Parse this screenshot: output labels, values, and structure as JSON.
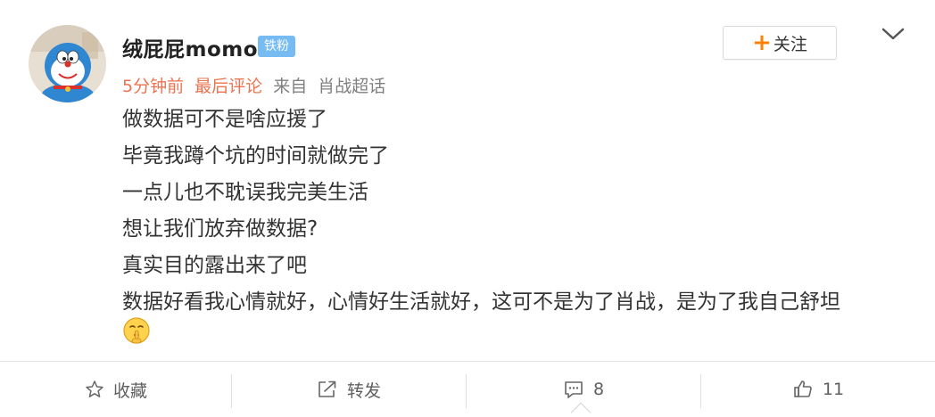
{
  "user": {
    "name": "绒屁屁momo",
    "badge": "铁粉"
  },
  "meta": {
    "time": "5分钟前",
    "last_comment": "最后评论",
    "from": "来自",
    "source": "肖战超话"
  },
  "follow": {
    "plus": "+",
    "label": "关注"
  },
  "content": {
    "lines": [
      "做数据可不是啥应援了",
      "毕竟我蹲个坑的时间就做完了",
      "一点儿也不耽误我完美生活",
      "想让我们放弃做数据?",
      "真实目的露出来了吧",
      "数据好看我心情就好，心情好生活就好，这可不是为了肖战，是为了我自己舒坦"
    ],
    "emoji": "shushing-face"
  },
  "actions": {
    "favorite": {
      "label": "收藏",
      "icon": "star-icon"
    },
    "repost": {
      "label": "转发",
      "icon": "share-icon"
    },
    "comment": {
      "count": "8",
      "icon": "comment-icon"
    },
    "like": {
      "count": "11",
      "icon": "thumbs-up-icon"
    }
  },
  "colors": {
    "accent_orange": "#ff8200",
    "meta_red": "#eb7350",
    "badge_blue": "#76bcf3"
  }
}
